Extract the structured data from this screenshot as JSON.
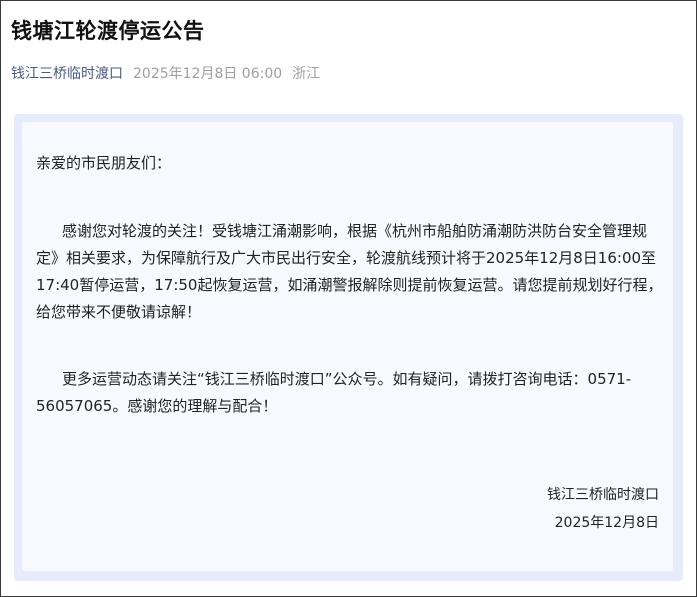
{
  "article": {
    "title": "钱塘江轮渡停运公告",
    "source": "钱江三桥临时渡口",
    "datetime": "2025年12月8日 06:00",
    "region": "浙江"
  },
  "notice": {
    "greeting": "亲爱的市民朋友们：",
    "paragraph1": "感谢您对轮渡的关注！受钱塘江涌潮影响，根据《杭州市船舶防涌潮防洪防台安全管理规定》相关要求，为保障航行及广大市民出行安全，轮渡航线预计将于2025年12月8日16:00至17:40暂停运营，17:50起恢复运营，如涌潮警报解除则提前恢复运营。请您提前规划好行程，给您带来不便敬请谅解！",
    "paragraph2": "更多运营动态请关注“钱江三桥临时渡口”公众号。如有疑问，请拨打咨询电话：0571-56057065。感谢您的理解与配合！",
    "signature_org": "钱江三桥临时渡口",
    "signature_date": "2025年12月8日"
  }
}
